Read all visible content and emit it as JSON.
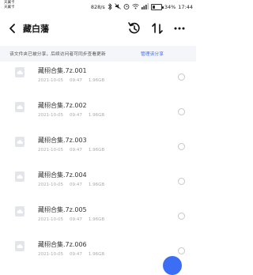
{
  "status": {
    "carrier_line1": "天翼卡",
    "carrier_line2": "天翼卡",
    "net_speed": "828/s",
    "battery": "34%",
    "battery_level": 0.34,
    "time": "17:44",
    "icons": [
      "bluetooth-icon",
      "mute-icon",
      "alarm-icon",
      "wifi-icon",
      "signal-icon"
    ]
  },
  "header": {
    "title": "藏白藩",
    "icons": [
      "back-arrow-icon",
      "history-icon",
      "sort-icon",
      "more-icon"
    ]
  },
  "notice": {
    "text": "该文件夹已被分享，后续访问者可同步查看更新",
    "link": "管理该分享"
  },
  "files": [
    {
      "name": "藏栩合集.7z.001",
      "date": "2021-10-05",
      "time": "09:47",
      "size": "1.96GB"
    },
    {
      "name": "藏栩合集.7z.002",
      "date": "2021-10-05",
      "time": "09:47",
      "size": "1.96GB"
    },
    {
      "name": "藏栩合集.7z.003",
      "date": "2021-10-05",
      "time": "09:47",
      "size": "1.96GB"
    },
    {
      "name": "藏栩合集.7z.004",
      "date": "2021-10-05",
      "time": "09:47",
      "size": "1.96GB"
    },
    {
      "name": "藏栩合集.7z.005",
      "date": "2021-10-05",
      "time": "09:47",
      "size": "1.96GB"
    },
    {
      "name": "藏栩合集.7z.006",
      "date": "2021-10-05",
      "time": "09:47",
      "size": "1.96GB"
    }
  ],
  "colors": {
    "accent": "#3b6ef5",
    "notice_bg": "#f5f6fa",
    "icon_bg": "#e3e5ea"
  }
}
